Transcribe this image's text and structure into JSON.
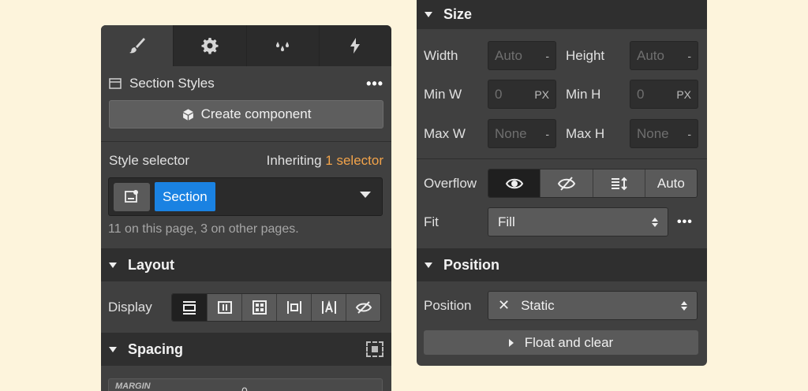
{
  "left": {
    "tabs": [
      {
        "icon": "brush-icon",
        "active": true
      },
      {
        "icon": "gear-icon",
        "active": false
      },
      {
        "icon": "drops-icon",
        "active": false
      },
      {
        "icon": "lightning-icon",
        "active": false
      }
    ],
    "title": "Section Styles",
    "more": "•••",
    "create_component": "Create component",
    "style_selector_label": "Style selector",
    "inheriting_prefix": "Inheriting",
    "inheriting_count": "1 selector",
    "selector_tag": "Section",
    "usage_hint": "11 on this page, 3 on other pages.",
    "layout_header": "Layout",
    "display_label": "Display",
    "display_options": [
      "block-icon",
      "flex-icon",
      "grid-icon",
      "inline-block-icon",
      "inline-icon",
      "none-icon"
    ],
    "spacing_header": "Spacing",
    "margin_label": "MARGIN",
    "margin_value": "0"
  },
  "right": {
    "size_header": "Size",
    "width_label": "Width",
    "width_value": "Auto",
    "width_unit": "-",
    "height_label": "Height",
    "height_value": "Auto",
    "height_unit": "-",
    "minw_label": "Min W",
    "minw_value": "0",
    "minw_unit": "PX",
    "minh_label": "Min H",
    "minh_value": "0",
    "minh_unit": "PX",
    "maxw_label": "Max W",
    "maxw_value": "None",
    "maxw_unit": "-",
    "maxh_label": "Max H",
    "maxh_value": "None",
    "maxh_unit": "-",
    "overflow_label": "Overflow",
    "overflow_auto": "Auto",
    "fit_label": "Fit",
    "fit_value": "Fill",
    "fit_more": "•••",
    "position_header": "Position",
    "position_label": "Position",
    "position_value": "Static",
    "position_clear": "✕",
    "float_clear": "Float and clear"
  },
  "colors": {
    "accent": "#1a82e2",
    "orange": "#f2a34a",
    "panel": "#404040",
    "background": "#fdf4dc"
  }
}
